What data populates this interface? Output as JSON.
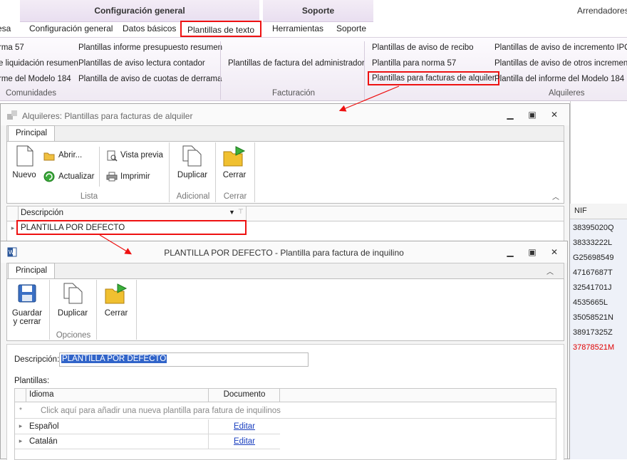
{
  "ribbon": {
    "groups": [
      {
        "title": "Configuración general"
      },
      {
        "title": "Soporte"
      }
    ],
    "right_label": "Arrendadores",
    "tabs": [
      "esa",
      "Configuración general",
      "Datos básicos",
      "Plantillas de texto",
      "Herramientas",
      "Soporte"
    ],
    "items": {
      "col1": [
        "rma 57",
        "e liquidación resumen",
        "rme del Modelo 184"
      ],
      "col2": [
        "Plantillas informe presupuesto resumen",
        "Plantillas de aviso lectura contador",
        "Plantilla de aviso de cuotas de derrama"
      ],
      "col3": [
        "Plantillas de factura del administrador"
      ],
      "col4": [
        "Plantillas de aviso de recibo",
        "Plantilla para norma 57",
        "Plantillas para facturas de alquiler"
      ],
      "col5": [
        "Plantillas de aviso de incremento IPC",
        "Plantillas de aviso de otros incrementos",
        "Plantilla del informe del Modelo 184"
      ]
    },
    "group_labels": [
      "Comunidades",
      "Facturación",
      "Alquileres"
    ]
  },
  "bg_grid": {
    "header": "NIF",
    "values": [
      "38395020Q",
      "38333222L",
      "G25698549",
      "47167687T",
      "32541701J",
      "4535665L",
      "35058521N",
      "38917325Z",
      "37878521M"
    ],
    "highlight_color": "#e00000"
  },
  "window1": {
    "title": "Alquileres: Plantillas para facturas de alquiler",
    "tab": "Principal",
    "buttons": {
      "nuevo": "Nuevo",
      "abrir": "Abrir...",
      "actualizar": "Actualizar",
      "vista_previa": "Vista previa",
      "imprimir": "Imprimir",
      "duplicar": "Duplicar",
      "cerrar": "Cerrar"
    },
    "groups": [
      "Lista",
      "Adicional",
      "Cerrar"
    ],
    "grid": {
      "header": "Descripción",
      "rows": [
        "PLANTILLA POR DEFECTO"
      ]
    }
  },
  "window2": {
    "title": "PLANTILLA POR DEFECTO - Plantilla para factura de inquilino",
    "tab": "Principal",
    "buttons": {
      "guardar_l1": "Guardar",
      "guardar_l2": "y cerrar",
      "duplicar": "Duplicar",
      "cerrar": "Cerrar"
    },
    "group": "Opciones",
    "descripcion_label": "Descripción:",
    "descripcion_value": "PLANTILLA POR DEFECTO",
    "plantillas_label": "Plantillas:",
    "grid": {
      "columns": [
        "Idioma",
        "Documento"
      ],
      "new_row_hint": "Click aquí para añadir una nueva plantilla para fatura de inquilinos",
      "rows": [
        {
          "idioma": "Español",
          "documento": "Editar"
        },
        {
          "idioma": "Catalán",
          "documento": "Editar"
        }
      ]
    }
  },
  "accent_color": "#e11111"
}
